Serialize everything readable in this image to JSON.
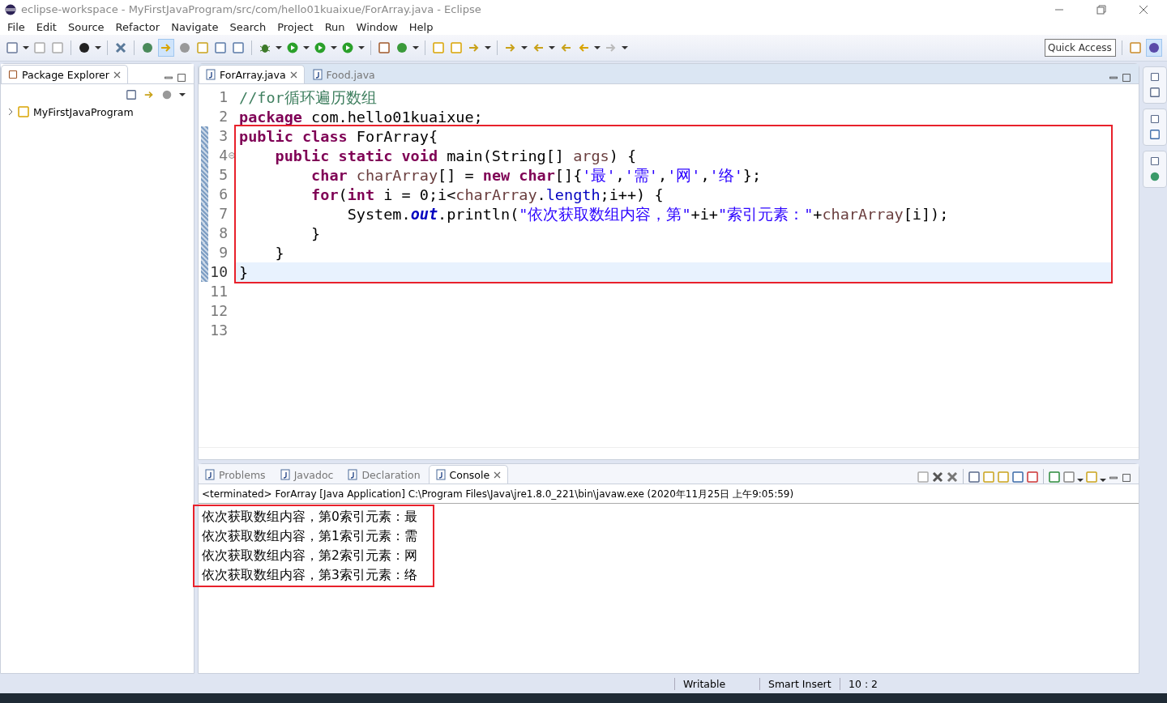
{
  "window": {
    "title": "eclipse-workspace - MyFirstJavaProgram/src/com/hello01kuaixue/ForArray.java - Eclipse"
  },
  "menu": [
    "File",
    "Edit",
    "Source",
    "Refactor",
    "Navigate",
    "Search",
    "Project",
    "Run",
    "Window",
    "Help"
  ],
  "quick_access": {
    "placeholder": "Quick Access"
  },
  "package_explorer": {
    "title": "Package Explorer",
    "items": [
      {
        "label": "MyFirstJavaProgram",
        "expanded": false
      }
    ]
  },
  "editor": {
    "tabs": [
      {
        "label": "ForArray.java",
        "selected": true
      },
      {
        "label": "Food.java",
        "selected": false
      }
    ],
    "blocks": [
      {
        "highlighted": false,
        "lines": [
          {
            "number": "1",
            "changed": false,
            "folding": false,
            "selected": false,
            "tokens": [
              {
                "kind": "comment",
                "text": "//for循环遍历数组"
              }
            ]
          },
          {
            "number": "2",
            "changed": false,
            "folding": false,
            "selected": false,
            "tokens": [
              {
                "kind": "keyword",
                "text": "package"
              },
              {
                "kind": "plain",
                "text": " com.hello01kuaixue;"
              }
            ]
          }
        ]
      },
      {
        "highlighted": true,
        "lines": [
          {
            "number": "3",
            "changed": true,
            "folding": false,
            "selected": false,
            "tokens": [
              {
                "kind": "keyword",
                "text": "public class"
              },
              {
                "kind": "plain",
                "text": " ForArray{"
              }
            ]
          },
          {
            "number": "4",
            "changed": true,
            "folding": true,
            "selected": false,
            "tokens": [
              {
                "kind": "keyword",
                "text": "    public static void"
              },
              {
                "kind": "plain",
                "text": " main(String[] "
              },
              {
                "kind": "param",
                "text": "args"
              },
              {
                "kind": "plain",
                "text": ") {"
              }
            ]
          },
          {
            "number": "5",
            "changed": true,
            "folding": false,
            "selected": false,
            "tokens": [
              {
                "kind": "keyword",
                "text": "        char "
              },
              {
                "kind": "local",
                "text": "charArray"
              },
              {
                "kind": "plain",
                "text": "[] = "
              },
              {
                "kind": "keyword",
                "text": "new char"
              },
              {
                "kind": "plain",
                "text": "[]{"
              },
              {
                "kind": "string",
                "text": "'最'"
              },
              {
                "kind": "plain",
                "text": ","
              },
              {
                "kind": "string",
                "text": "'需'"
              },
              {
                "kind": "plain",
                "text": ","
              },
              {
                "kind": "string",
                "text": "'网'"
              },
              {
                "kind": "plain",
                "text": ","
              },
              {
                "kind": "string",
                "text": "'络'"
              },
              {
                "kind": "plain",
                "text": "};"
              }
            ]
          },
          {
            "number": "6",
            "changed": true,
            "folding": false,
            "selected": false,
            "tokens": [
              {
                "kind": "keyword",
                "text": "        for"
              },
              {
                "kind": "plain",
                "text": "("
              },
              {
                "kind": "keyword",
                "text": "int"
              },
              {
                "kind": "plain",
                "text": " i = 0;i<"
              },
              {
                "kind": "local",
                "text": "charArray"
              },
              {
                "kind": "plain",
                "text": "."
              },
              {
                "kind": "field",
                "text": "length"
              },
              {
                "kind": "plain",
                "text": ";i++) {"
              }
            ]
          },
          {
            "number": "7",
            "changed": true,
            "folding": false,
            "selected": false,
            "tokens": [
              {
                "kind": "plain",
                "text": "            System."
              },
              {
                "kind": "static",
                "text": "out"
              },
              {
                "kind": "plain",
                "text": ".println("
              },
              {
                "kind": "string",
                "text": "\"依次获取数组内容，第\""
              },
              {
                "kind": "plain",
                "text": "+i+"
              },
              {
                "kind": "string",
                "text": "\"索引元素：\""
              },
              {
                "kind": "plain",
                "text": "+"
              },
              {
                "kind": "local",
                "text": "charArray"
              },
              {
                "kind": "plain",
                "text": "[i]);"
              }
            ]
          },
          {
            "number": "8",
            "changed": true,
            "folding": false,
            "selected": false,
            "tokens": [
              {
                "kind": "plain",
                "text": "        }"
              }
            ]
          },
          {
            "number": "9",
            "changed": true,
            "folding": false,
            "selected": false,
            "tokens": [
              {
                "kind": "plain",
                "text": "    }"
              }
            ]
          },
          {
            "number": "10",
            "changed": true,
            "folding": false,
            "selected": true,
            "tokens": [
              {
                "kind": "plain",
                "text": "}"
              }
            ]
          }
        ]
      },
      {
        "highlighted": false,
        "lines": [
          {
            "number": "11",
            "changed": false,
            "folding": false,
            "selected": false
          },
          {
            "number": "12",
            "changed": false,
            "folding": false,
            "selected": false
          },
          {
            "number": "13",
            "changed": false,
            "folding": false,
            "selected": false
          }
        ]
      }
    ]
  },
  "bottom_panel": {
    "tabs": [
      {
        "label": "Problems",
        "selected": false
      },
      {
        "label": "Javadoc",
        "selected": false
      },
      {
        "label": "Declaration",
        "selected": false
      },
      {
        "label": "Console",
        "selected": true
      }
    ],
    "status": "<terminated> ForArray [Java Application] C:\\Program Files\\Java\\jre1.8.0_221\\bin\\javaw.exe (2020年11月25日 上午9:05:59)",
    "output": {
      "highlighted": true,
      "lines": [
        "依次获取数组内容，第0索引元素：最",
        "依次获取数组内容，第1索引元素：需",
        "依次获取数组内容，第2索引元素：网",
        "依次获取数组内容，第3索引元素：络"
      ]
    }
  },
  "status_bar": [
    "Writable",
    "Smart Insert",
    "10 : 2"
  ]
}
